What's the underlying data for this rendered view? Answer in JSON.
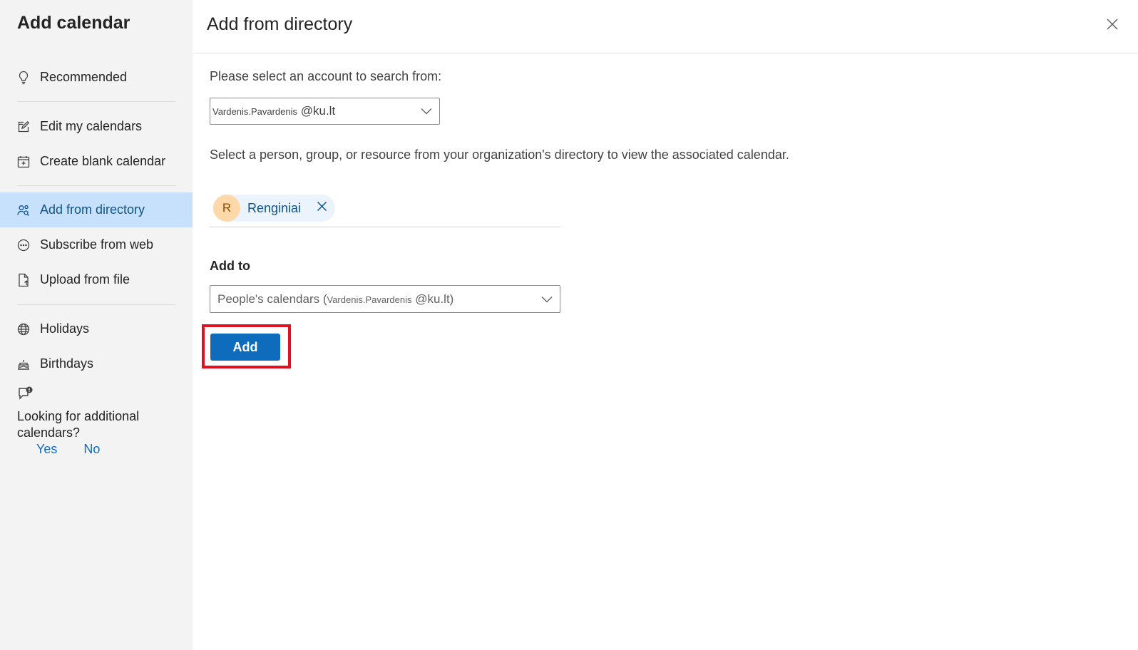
{
  "sidebar": {
    "title": "Add calendar",
    "items": [
      {
        "label": "Recommended",
        "icon": "lightbulb-icon"
      },
      {
        "label": "Edit my calendars",
        "icon": "edit-calendar-icon"
      },
      {
        "label": "Create blank calendar",
        "icon": "calendar-add-icon"
      },
      {
        "label": "Add from directory",
        "icon": "people-search-icon",
        "selected": true
      },
      {
        "label": "Subscribe from web",
        "icon": "web-link-icon"
      },
      {
        "label": "Upload from file",
        "icon": "file-upload-icon"
      },
      {
        "label": "Holidays",
        "icon": "globe-icon"
      },
      {
        "label": "Birthdays",
        "icon": "cake-icon"
      }
    ],
    "feedback": {
      "icon": "feedback-icon",
      "question": "Looking for additional calendars?",
      "yes": "Yes",
      "no": "No"
    }
  },
  "main": {
    "title": "Add from directory",
    "account_prompt": "Please select an account to search from:",
    "account": {
      "user": "Vardenis.Pavardenis",
      "domain": "@ku.lt"
    },
    "directory_prompt": "Select a person, group, or resource from your organization's directory to view the associated calendar.",
    "selected_chip": {
      "initial": "R",
      "name": "Renginiai"
    },
    "add_to_label": "Add to",
    "add_to": {
      "prefix": "People's calendars (",
      "user": "Vardenis.Pavardenis",
      "suffix": "@ku.lt)"
    },
    "add_button": "Add"
  },
  "colors": {
    "accent": "#0f6cbd",
    "selected_bg": "#c7e0fb",
    "highlight": "#e0101e",
    "avatar_bg": "#fed8a8"
  }
}
